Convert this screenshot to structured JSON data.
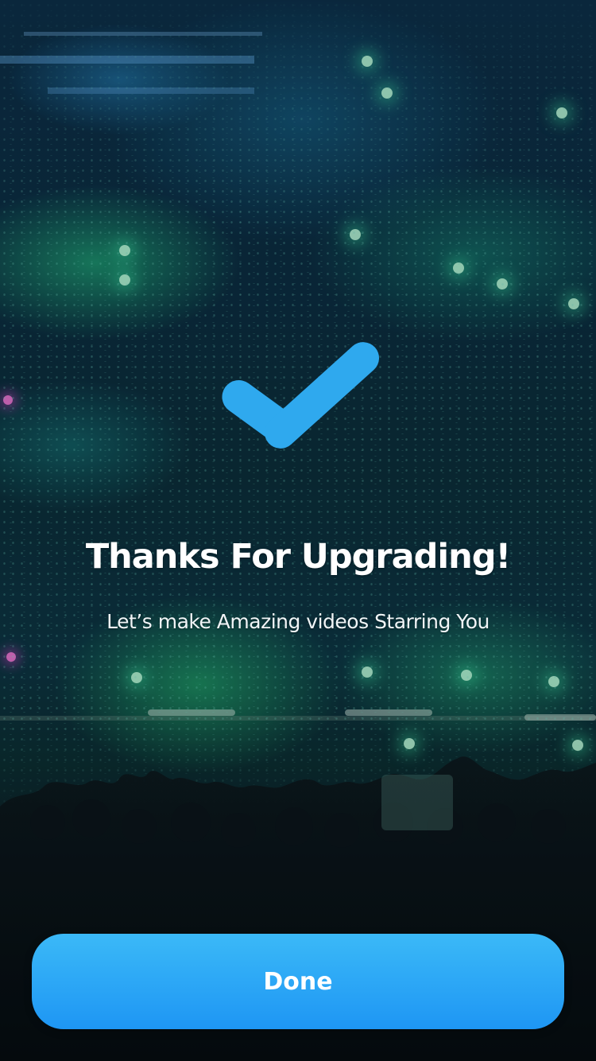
{
  "background": {
    "description_icon": "concert-photo-background"
  },
  "success": {
    "icon": "checkmark-icon",
    "icon_color": "#2fa9ee",
    "title": "Thanks For Upgrading!",
    "subtitle": "Let’s make Amazing videos Starring You"
  },
  "actions": {
    "done_label": "Done",
    "done_color_top": "#3bb9f7",
    "done_color_bottom": "#1e96f4"
  }
}
